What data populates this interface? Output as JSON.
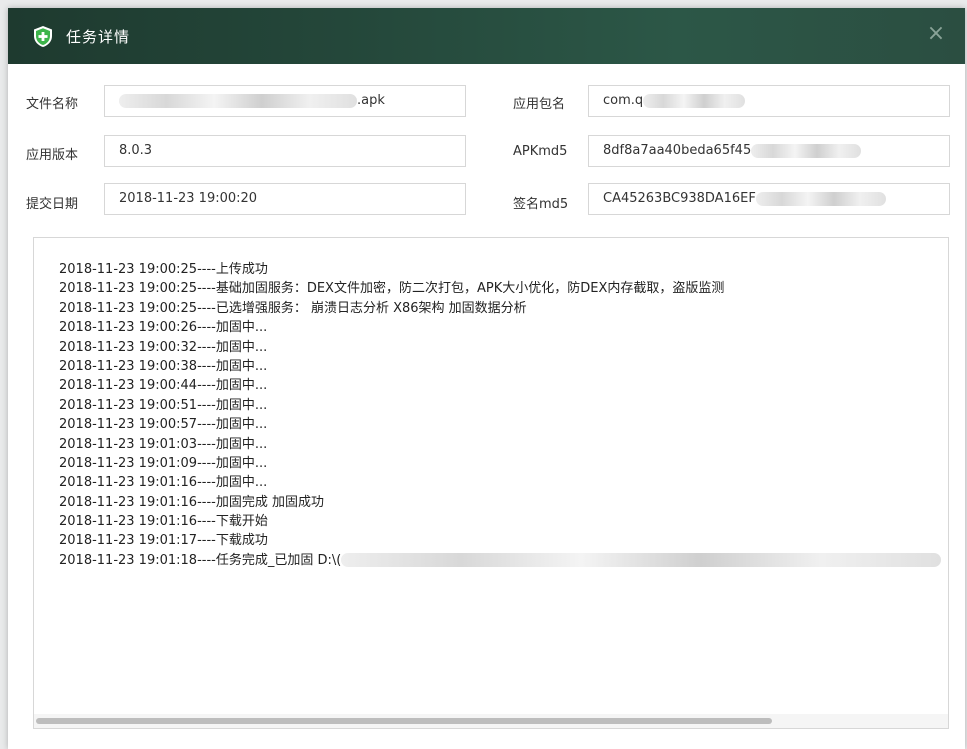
{
  "window": {
    "title": "任务详情",
    "close_symbol": "×"
  },
  "icons": {
    "logo": "shield-plus-icon",
    "close": "close-icon"
  },
  "colors": {
    "titlebar": "#24473a",
    "logo_green": "#3cb44a"
  },
  "fields": {
    "file_name": {
      "label": "文件名称",
      "value": ".apk"
    },
    "package_name": {
      "label": "应用包名",
      "value": "com.q"
    },
    "app_version": {
      "label": "应用版本",
      "value": "8.0.3"
    },
    "apk_md5": {
      "label": "APKmd5",
      "value": "8df8a7aa40beda65f45"
    },
    "submit_date": {
      "label": "提交日期",
      "value": "2018-11-23 19:00:20"
    },
    "sign_md5": {
      "label": "签名md5",
      "value": "CA45263BC938DA16EF"
    }
  },
  "log": {
    "lines": [
      "2018-11-23 19:00:25----上传成功",
      "2018-11-23 19:00:25----基础加固服务：DEX文件加密，防二次打包，APK大小优化，防DEX内存截取，盗版监测",
      "2018-11-23 19:00:25----已选增强服务：  崩溃日志分析  X86架构  加固数据分析",
      "2018-11-23 19:00:26----加固中...",
      "2018-11-23 19:00:32----加固中...",
      "2018-11-23 19:00:38----加固中...",
      "2018-11-23 19:00:44----加固中...",
      "2018-11-23 19:00:51----加固中...",
      "2018-11-23 19:00:57----加固中...",
      "2018-11-23 19:01:03----加固中...",
      "2018-11-23 19:01:09----加固中...",
      "2018-11-23 19:01:16----加固中...",
      "2018-11-23 19:01:16----加固完成 加固成功",
      "2018-11-23 19:01:16----下载开始",
      "2018-11-23 19:01:17----下载成功",
      "2018-11-23 19:01:18----任务完成_已加固 D:\\("
    ]
  }
}
